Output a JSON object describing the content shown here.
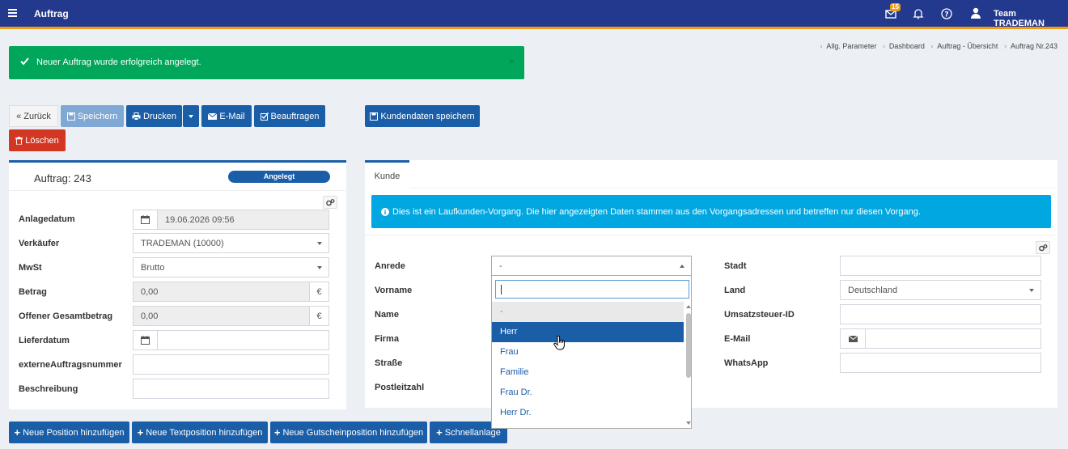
{
  "header": {
    "title": "Auftrag",
    "mail_badge": "15",
    "user": "Team TRADEMAN"
  },
  "breadcrumb": [
    "Allg. Parameter",
    "Dashboard",
    "Auftrag - Übersicht",
    "Auftrag Nr.243"
  ],
  "alert": {
    "message": "Neuer Auftrag wurde erfolgreich angelegt.",
    "close": "×"
  },
  "toolbar": {
    "back": "Zurück",
    "save": "Speichern",
    "print": "Drucken",
    "email": "E-Mail",
    "commission": "Beauftragen",
    "save_customer": "Kundendaten speichern",
    "delete": "Löschen"
  },
  "order": {
    "title": "Auftrag: 243",
    "status": "Angelegt",
    "fields": {
      "created_label": "Anlagedatum",
      "created_value": "19.06.2026 09:56",
      "seller_label": "Verkäufer",
      "seller_value": "TRADEMAN (10000)",
      "vat_label": "MwSt",
      "vat_value": "Brutto",
      "amount_label": "Betrag",
      "amount_value": "0,00",
      "currency": "€",
      "open_label": "Offener Gesamtbetrag",
      "open_value": "0,00",
      "delivery_label": "Lieferdatum",
      "delivery_value": "",
      "ext_label": "externeAuftragsnummer",
      "ext_value": "",
      "desc_label": "Beschreibung",
      "desc_value": ""
    }
  },
  "customer": {
    "tab": "Kunde",
    "info": "Dies ist ein Laufkunden-Vorgang. Die hier angezeigten Daten stammen aus den Vorgangsadressen und betreffen nur diesen Vorgang.",
    "labels": {
      "salutation": "Anrede",
      "firstname": "Vorname",
      "name": "Name",
      "company": "Firma",
      "street": "Straße",
      "zip": "Postleitzahl",
      "city": "Stadt",
      "country": "Land",
      "vatid": "Umsatzsteuer-ID",
      "email": "E-Mail",
      "whatsapp": "WhatsApp"
    },
    "salutation_value": "-",
    "country_value": "Deutschland",
    "dropdown_options": [
      "-",
      "Herr",
      "Frau",
      "Familie",
      "Frau Dr.",
      "Herr Dr."
    ],
    "dropdown_selected": "Herr"
  },
  "bottom_buttons": {
    "new_position": "Neue Position hinzufügen",
    "new_text": "Neue Textposition hinzufügen",
    "new_voucher": "Neue Gutscheinposition hinzufügen",
    "quick": "Schnellanlage"
  },
  "colors": {
    "header": "#22398e",
    "accent": "#f39c12",
    "primary": "#1a5ea8",
    "success": "#00a65a",
    "danger": "#d33724",
    "info": "#00a7e0"
  }
}
